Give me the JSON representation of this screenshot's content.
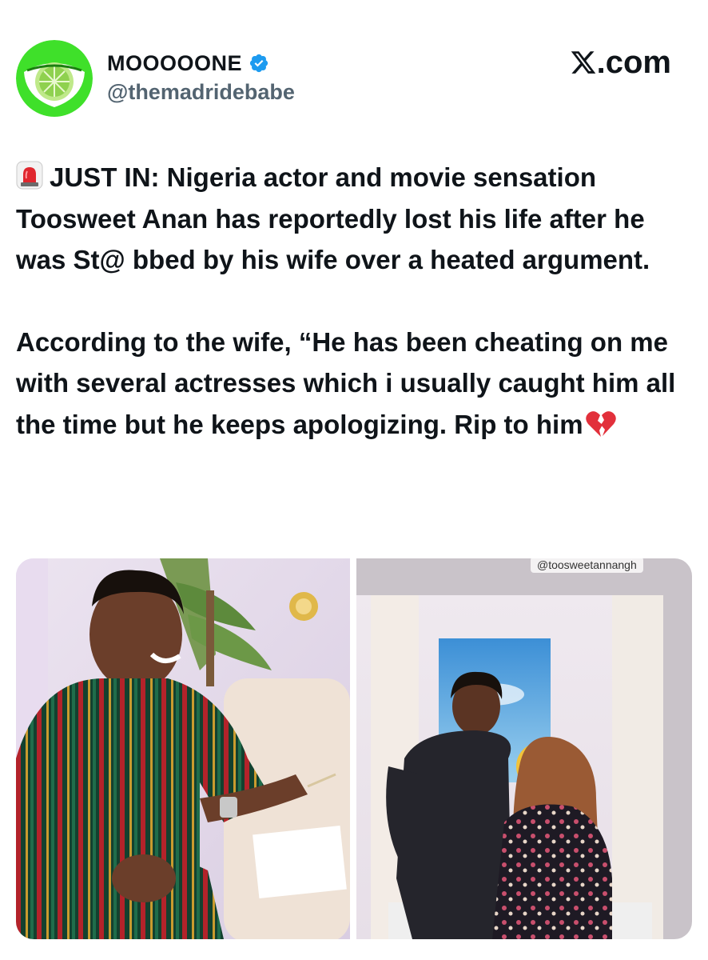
{
  "tweet": {
    "display_name": "MOOOOONE",
    "handle": "@themadridebabe",
    "site_label": ".com",
    "text_paragraphs": [
      "JUST IN: Nigeria actor and movie sensation Toosweet Anan has  reportedly lost his life after he was St@ bbed by his wife over a heated argument.",
      "According to the wife, “He has been cheating on me with several actresses which i usually caught him all the time but he keeps apologizing. Rip to him"
    ],
    "media": {
      "watermark": "@toosweetannangh"
    }
  },
  "icons": {
    "verified": "verified-badge-icon",
    "x_logo": "x-logo-icon",
    "siren": "siren-emoji",
    "heart": "broken-heart-emoji"
  },
  "colors": {
    "verified_blue": "#1d9bf0",
    "text": "#0f1419",
    "handle_gray": "#536471",
    "avatar_green": "#3fe02a"
  }
}
